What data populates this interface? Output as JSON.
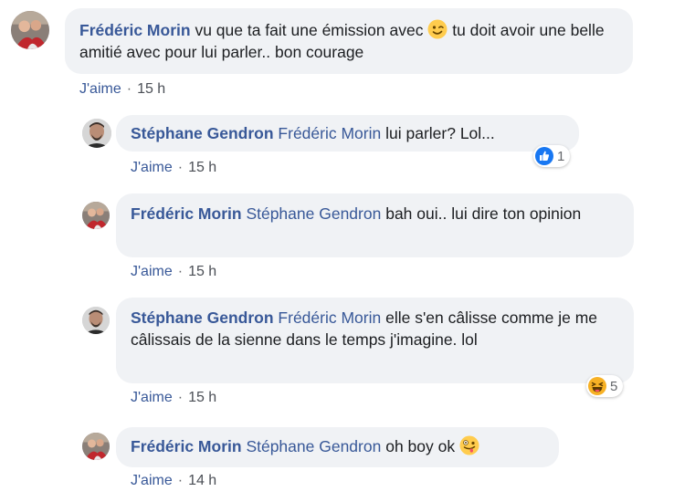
{
  "comments": [
    {
      "author": "Frédéric Morin",
      "text_before": "vu que ta fait une émission avec",
      "emoji": "winking-face-emoji",
      "text_after": "tu doit avoir une belle amitié avec pour lui parler.. bon courage",
      "like_label": "J'aime",
      "separator": "·",
      "time": "15 h"
    },
    {
      "author": "Stéphane Gendron",
      "mention": "Frédéric Morin",
      "text": "lui parler? Lol...",
      "like_label": "J'aime",
      "separator": "·",
      "time": "15 h",
      "reaction": {
        "icon": "like-reaction-icon",
        "count": "1"
      }
    },
    {
      "author": "Frédéric Morin",
      "mention": "Stéphane Gendron",
      "text": "bah oui.. lui dire ton opinion",
      "like_label": "J'aime",
      "separator": "·",
      "time": "15 h"
    },
    {
      "author": "Stéphane Gendron",
      "mention": "Frédéric Morin",
      "text": "elle s'en câlisse comme je me câlissais de la sienne dans le temps j'imagine. lol",
      "like_label": "J'aime",
      "separator": "·",
      "time": "15 h",
      "reaction": {
        "icon": "haha-reaction-icon",
        "count": "5"
      }
    },
    {
      "author": "Frédéric Morin",
      "mention": "Stéphane Gendron",
      "text": "oh boy ok",
      "emoji": "zany-face-emoji",
      "like_label": "J'aime",
      "separator": "·",
      "time": "14 h"
    }
  ],
  "colors": {
    "link": "#385898",
    "bubble": "#f0f2f5",
    "like_blue": "#1877f2",
    "haha_yellow": "#f7b125"
  }
}
